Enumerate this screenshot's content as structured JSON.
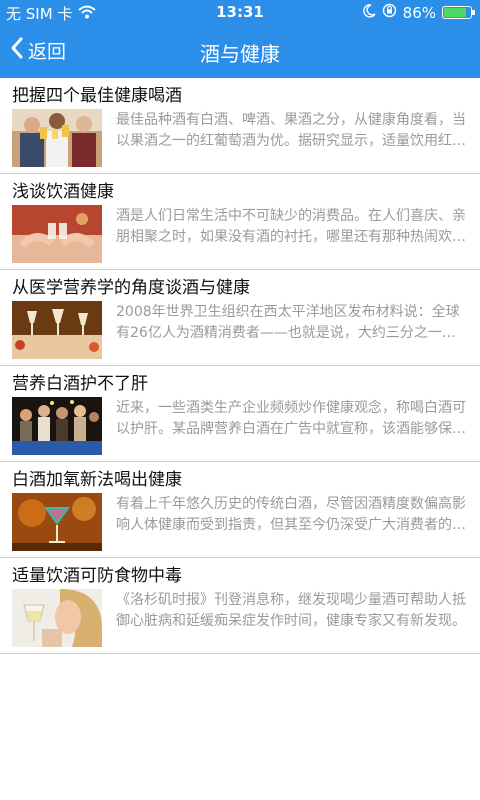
{
  "status_bar": {
    "carrier": "无 SIM 卡",
    "time": "13:31",
    "battery_percent": "86%",
    "battery_level": 0.86
  },
  "nav": {
    "back_label": "返回",
    "title": "酒与健康"
  },
  "articles": [
    {
      "title": "把握四个最佳健康喝酒",
      "summary": "最佳品种酒有白酒、啤酒、果酒之分，从健康角度看，当以果酒之一的红葡萄酒为优。据研究显示，适量饮用红葡萄酒能降低心血管疾病的发病率。",
      "thumb_icon": "friends-toasting-beer-image"
    },
    {
      "title": "浅谈饮酒健康",
      "summary": "酒是人们日常生活中不可缺少的消费品。在人们喜庆、亲朋相聚之时，如果没有酒的衬托，哪里还有那种热闹欢乐的气氛。",
      "thumb_icon": "glasses-clinking-image"
    },
    {
      "title": "从医学营养学的角度谈酒与健康",
      "summary": "2008年世界卫生组织在西太平洋地区发布材料说：全球有26亿人为酒精消费者——也就是说，大约三分之一的人口在饮酒。",
      "thumb_icon": "dining-table-wine-glasses-image"
    },
    {
      "title": "营养白酒护不了肝",
      "summary": "近来，一些酒类生产企业频频炒作健康观念，称喝白酒可以护肝。某品牌营养白酒在广告中就宣称，该酒能够保护肝脏。",
      "thumb_icon": "bar-party-crowd-image"
    },
    {
      "title": "白酒加氧新法喝出健康",
      "summary": "有着上千年悠久历史的传统白酒，尽管因酒精度数偏高影响人体健康而受到指责，但其至今仍深受广大消费者的喜爱。",
      "thumb_icon": "cocktail-glass-image"
    },
    {
      "title": "适量饮酒可防食物中毒",
      "summary": "《洛杉矶时报》刊登消息称，继发现喝少量酒可帮助人抵御心脏病和延缓痴呆症发作时间，健康专家又有新发现。",
      "thumb_icon": "woman-drinking-white-wine-image"
    }
  ]
}
